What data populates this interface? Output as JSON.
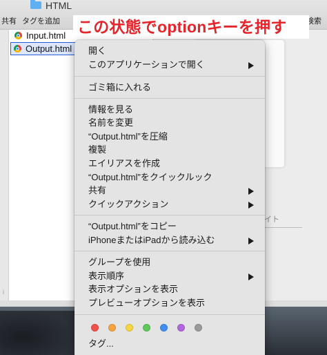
{
  "window": {
    "title": "HTML",
    "toolbar": {
      "share": "共有",
      "add_tag": "タグを追加",
      "search": "検索"
    }
  },
  "files": [
    {
      "name": "Input.html",
      "selected": false
    },
    {
      "name": "Output.html",
      "selected": true
    }
  ],
  "preview": {
    "partial_text": "イト"
  },
  "annotation": {
    "text": "この状態でoptionキーを押す",
    "color": "#e5242b"
  },
  "menu": {
    "groups": [
      [
        {
          "label": "開く",
          "submenu": false
        },
        {
          "label": "このアプリケーションで開く",
          "submenu": true
        }
      ],
      [
        {
          "label": "ゴミ箱に入れる",
          "submenu": false
        }
      ],
      [
        {
          "label": "情報を見る",
          "submenu": false
        },
        {
          "label": "名前を変更",
          "submenu": false
        },
        {
          "label": "“Output.html”を圧縮",
          "submenu": false
        },
        {
          "label": "複製",
          "submenu": false
        },
        {
          "label": "エイリアスを作成",
          "submenu": false
        },
        {
          "label": "“Output.html”をクイックルック",
          "submenu": false
        },
        {
          "label": "共有",
          "submenu": true
        },
        {
          "label": "クイックアクション",
          "submenu": true
        }
      ],
      [
        {
          "label": "“Output.html”をコピー",
          "submenu": false
        },
        {
          "label": "iPhoneまたはiPadから読み込む",
          "submenu": true
        }
      ],
      [
        {
          "label": "グループを使用",
          "submenu": false
        },
        {
          "label": "表示順序",
          "submenu": true
        },
        {
          "label": "表示オプションを表示",
          "submenu": false
        },
        {
          "label": "プレビューオプションを表示",
          "submenu": false
        }
      ]
    ],
    "tag_colors": [
      {
        "name": "red",
        "color": "#f0514c"
      },
      {
        "name": "orange",
        "color": "#f5a340"
      },
      {
        "name": "yellow",
        "color": "#f5d544"
      },
      {
        "name": "green",
        "color": "#5ec95a"
      },
      {
        "name": "blue",
        "color": "#3f8ef0"
      },
      {
        "name": "purple",
        "color": "#b265dc"
      },
      {
        "name": "gray",
        "color": "#9a9a9a"
      }
    ],
    "tags_label": "タグ..."
  }
}
